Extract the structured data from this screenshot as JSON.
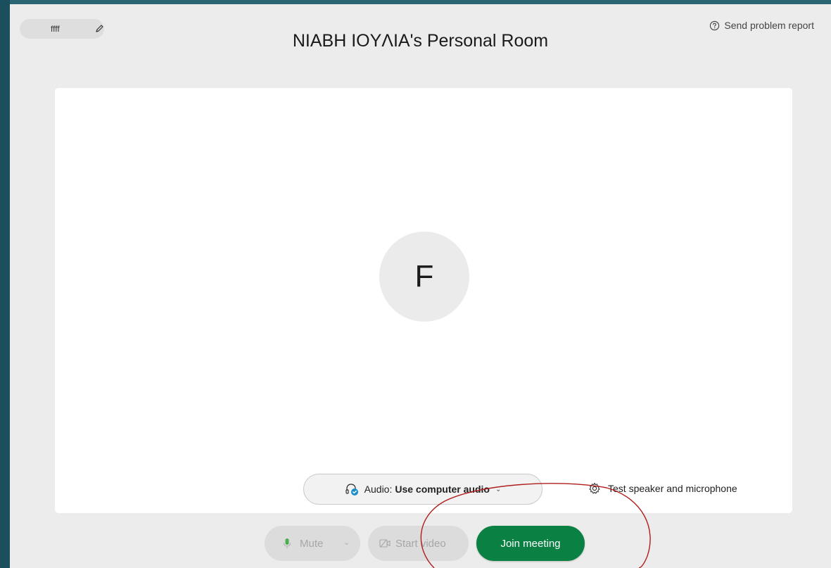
{
  "user": {
    "display_name": "ffff"
  },
  "meeting": {
    "room_title": "NIABH IOYΛIA's Personal Room",
    "avatar_initial": "F"
  },
  "header": {
    "report_label": "Send problem report"
  },
  "audio": {
    "prefix": "Audio:",
    "value": "Use computer audio"
  },
  "test": {
    "label": "Test speaker and microphone"
  },
  "controls": {
    "mute_label": "Mute",
    "video_label": "Start video",
    "join_label": "Join meeting"
  },
  "colors": {
    "join_green": "#0b8043",
    "annotation_red": "#b01d1d"
  },
  "icons": [
    "edit-icon",
    "help-icon",
    "headset-icon",
    "gear-icon",
    "microphone-icon",
    "camera-icon",
    "chevron-down-icon"
  ]
}
